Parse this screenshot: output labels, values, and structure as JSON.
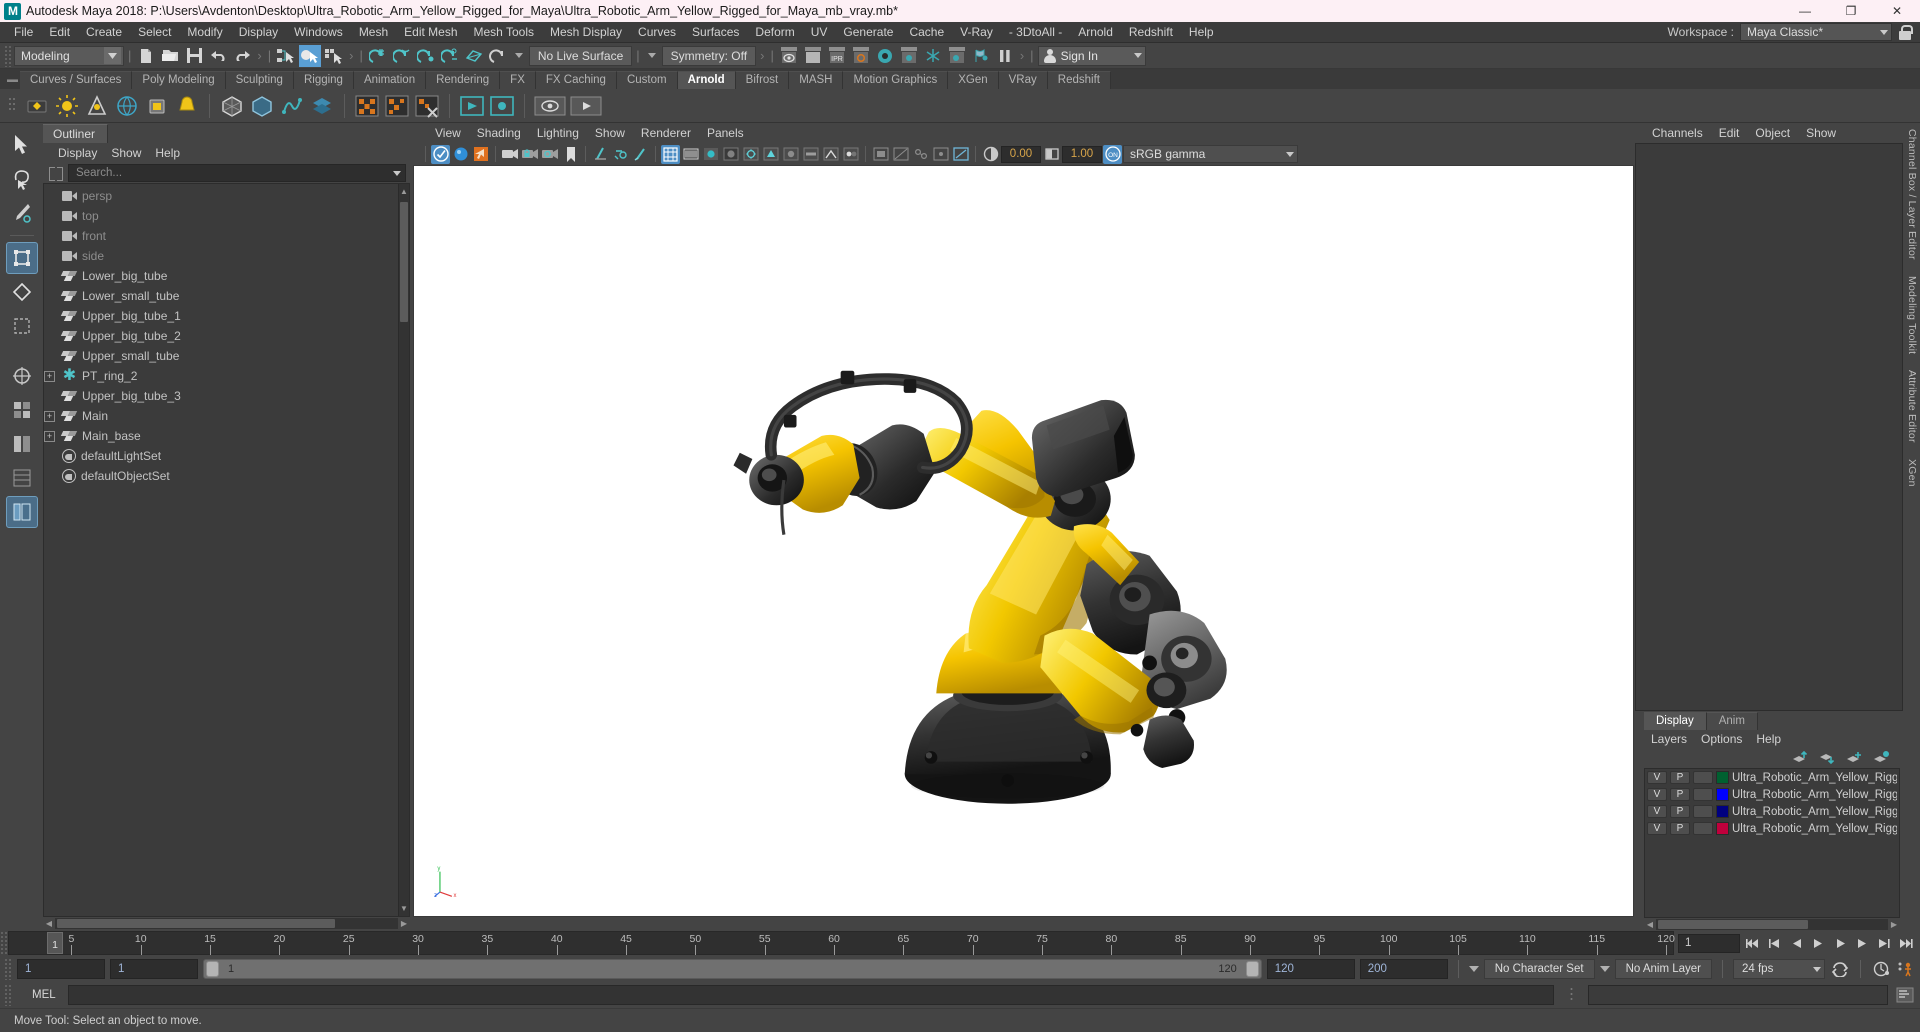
{
  "window": {
    "title": "Autodesk Maya 2018: P:\\Users\\Avdenton\\Desktop\\Ultra_Robotic_Arm_Yellow_Rigged_for_Maya\\Ultra_Robotic_Arm_Yellow_Rigged_for_Maya_mb_vray.mb*",
    "logo": "M",
    "minimize": "—",
    "maximize": "❐",
    "close": "✕"
  },
  "menubar": {
    "items": [
      "File",
      "Edit",
      "Create",
      "Select",
      "Modify",
      "Display",
      "Windows",
      "Mesh",
      "Edit Mesh",
      "Mesh Tools",
      "Mesh Display",
      "Curves",
      "Surfaces",
      "Deform",
      "UV",
      "Generate",
      "Cache",
      "V-Ray",
      "- 3DtoAll -",
      "Arnold",
      "Redshift",
      "Help"
    ],
    "workspace_label": "Workspace :",
    "workspace_value": "Maya Classic*"
  },
  "statusbar": {
    "mode": "Modeling",
    "live_surface": "No Live Surface",
    "symmetry": "Symmetry: Off",
    "signin": "Sign In"
  },
  "shelf": {
    "tabs": [
      "Curves / Surfaces",
      "Poly Modeling",
      "Sculpting",
      "Rigging",
      "Animation",
      "Rendering",
      "FX",
      "FX Caching",
      "Custom",
      "Arnold",
      "Bifrost",
      "MASH",
      "Motion Graphics",
      "XGen",
      "VRay",
      "Redshift"
    ],
    "active_tab": "Arnold"
  },
  "outliner": {
    "tab_label": "Outliner",
    "menus": [
      "Display",
      "Show",
      "Help"
    ],
    "search_placeholder": "Search...",
    "items": [
      {
        "label": "persp",
        "icon": "camera-icon",
        "dim": true,
        "expandable": false
      },
      {
        "label": "top",
        "icon": "camera-icon",
        "dim": true,
        "expandable": false
      },
      {
        "label": "front",
        "icon": "camera-icon",
        "dim": true,
        "expandable": false
      },
      {
        "label": "side",
        "icon": "camera-icon",
        "dim": true,
        "expandable": false
      },
      {
        "label": "Lower_big_tube",
        "icon": "mesh-icon",
        "dim": false,
        "expandable": false
      },
      {
        "label": "Lower_small_tube",
        "icon": "mesh-icon",
        "dim": false,
        "expandable": false
      },
      {
        "label": "Upper_big_tube_1",
        "icon": "mesh-icon",
        "dim": false,
        "expandable": false
      },
      {
        "label": "Upper_big_tube_2",
        "icon": "mesh-icon",
        "dim": false,
        "expandable": false
      },
      {
        "label": "Upper_small_tube",
        "icon": "mesh-icon",
        "dim": false,
        "expandable": false
      },
      {
        "label": "PT_ring_2",
        "icon": "star-icon",
        "dim": false,
        "expandable": true
      },
      {
        "label": "Upper_big_tube_3",
        "icon": "mesh-icon",
        "dim": false,
        "expandable": false
      },
      {
        "label": "Main",
        "icon": "mesh-icon",
        "dim": false,
        "expandable": true
      },
      {
        "label": "Main_base",
        "icon": "mesh-icon",
        "dim": false,
        "expandable": true
      },
      {
        "label": "defaultLightSet",
        "icon": "set-icon",
        "dim": false,
        "expandable": false
      },
      {
        "label": "defaultObjectSet",
        "icon": "set-icon",
        "dim": false,
        "expandable": false
      }
    ]
  },
  "viewport": {
    "menus": [
      "View",
      "Shading",
      "Lighting",
      "Show",
      "Renderer",
      "Panels"
    ],
    "exposure": "0.00",
    "gamma": "1.00",
    "colorspace": "sRGB gamma",
    "toggle_on_label": "ON",
    "ipr_label": "IPR",
    "background": "#ffffff",
    "axis": {
      "x": "x",
      "y": "y",
      "z": "z"
    }
  },
  "right_panel": {
    "channel_menus": [
      "Channels",
      "Edit",
      "Object",
      "Show"
    ],
    "vertical_tabs": [
      "Channel Box / Layer Editor",
      "Modeling Toolkit",
      "Attribute Editor",
      "XGen"
    ],
    "layer_tabs": [
      "Display",
      "Anim"
    ],
    "layer_active_tab": "Display",
    "layer_menus": [
      "Layers",
      "Options",
      "Help"
    ],
    "layers": [
      {
        "v": "V",
        "p": "P",
        "r": "",
        "color": "#006030",
        "name": "Ultra_Robotic_Arm_Yellow_Rigged_Bone"
      },
      {
        "v": "V",
        "p": "P",
        "r": "",
        "color": "#0000ff",
        "name": "Ultra_Robotic_Arm_Yellow_Rigged_Cont"
      },
      {
        "v": "V",
        "p": "P",
        "r": "",
        "color": "#000080",
        "name": "Ultra_Robotic_Arm_Yellow_Rigged_Help"
      },
      {
        "v": "V",
        "p": "P",
        "r": "",
        "color": "#c0003c",
        "name": "Ultra_Robotic_Arm_Yellow_Rigged_Geo"
      }
    ]
  },
  "timeline": {
    "current_frame": "1",
    "ticks": [
      5,
      10,
      15,
      20,
      25,
      30,
      35,
      40,
      45,
      50,
      55,
      60,
      65,
      70,
      75,
      80,
      85,
      90,
      95,
      100,
      105,
      110,
      115,
      120
    ],
    "range_start": 1,
    "range_end": 120,
    "frame_field": "1"
  },
  "rangebar": {
    "start_field": "1",
    "anim_start_field": "1",
    "slider_min": "1",
    "slider_max": "120",
    "end_field": "120",
    "anim_end_field": "200",
    "character_set": "No Character Set",
    "anim_layer": "No Anim Layer",
    "fps": "24 fps"
  },
  "command_line": {
    "label": "MEL",
    "value": ""
  },
  "help_line": {
    "text": "Move Tool: Select an object to move."
  },
  "colors": {
    "accent_blue": "#4d8ec4",
    "teal": "#4fc4c9",
    "orange": "#d8761e",
    "panel_bg": "#444444",
    "dark_bg": "#3b3b3b"
  }
}
